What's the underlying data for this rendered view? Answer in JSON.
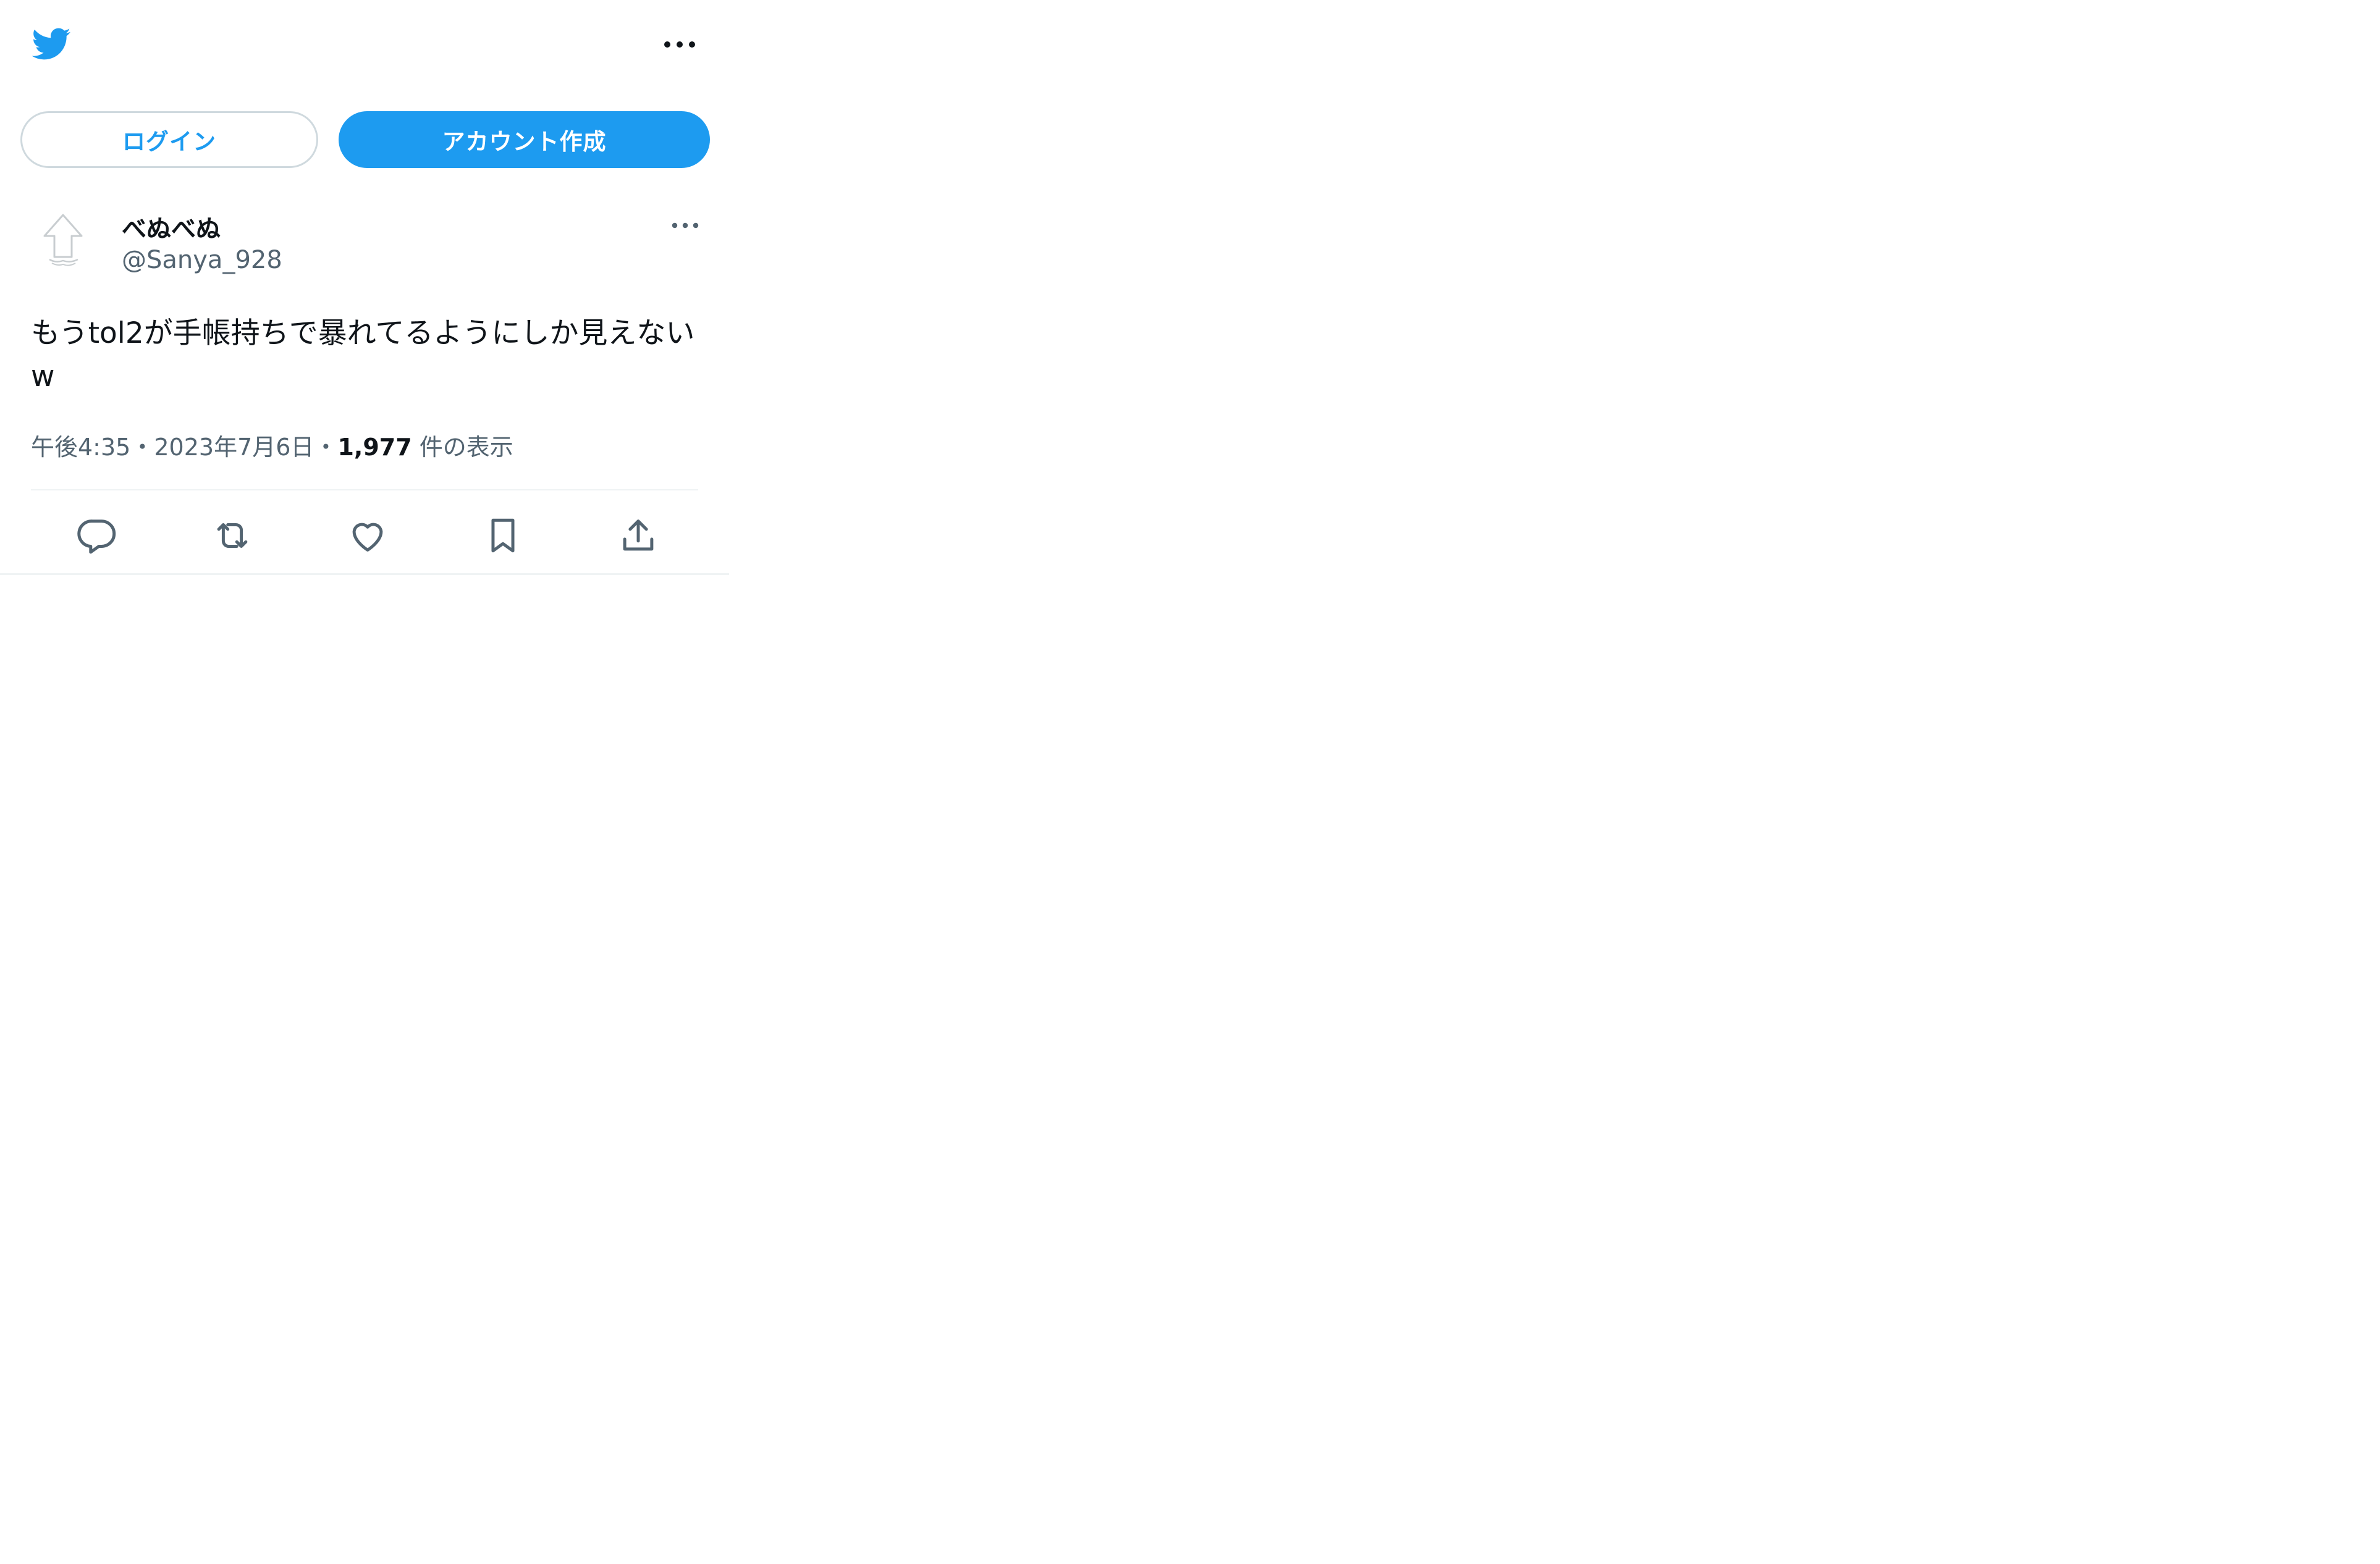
{
  "header": {
    "logo_icon": "twitter-bird-icon",
    "more_icon": "more-horizontal-icon",
    "brand_color": "#1d9bf0"
  },
  "auth": {
    "login_label": "ログイン",
    "signup_label": "アカウント作成"
  },
  "tweet": {
    "author": {
      "display_name": "べぬべぬ",
      "handle": "@Sanya_928",
      "avatar_icon": "default-avatar-icon"
    },
    "more_icon": "more-horizontal-icon",
    "text": "もうtol2が手帳持ちで暴れてるようにしか見えないw",
    "time": "午後4:35",
    "separator": "・",
    "date": "2023年7月6日",
    "views_count": "1,977",
    "views_label": "件の表示"
  },
  "actions": [
    {
      "name": "reply",
      "icon": "reply-icon"
    },
    {
      "name": "retweet",
      "icon": "retweet-icon"
    },
    {
      "name": "like",
      "icon": "heart-icon"
    },
    {
      "name": "bookmark",
      "icon": "bookmark-icon"
    },
    {
      "name": "share",
      "icon": "share-icon"
    }
  ]
}
